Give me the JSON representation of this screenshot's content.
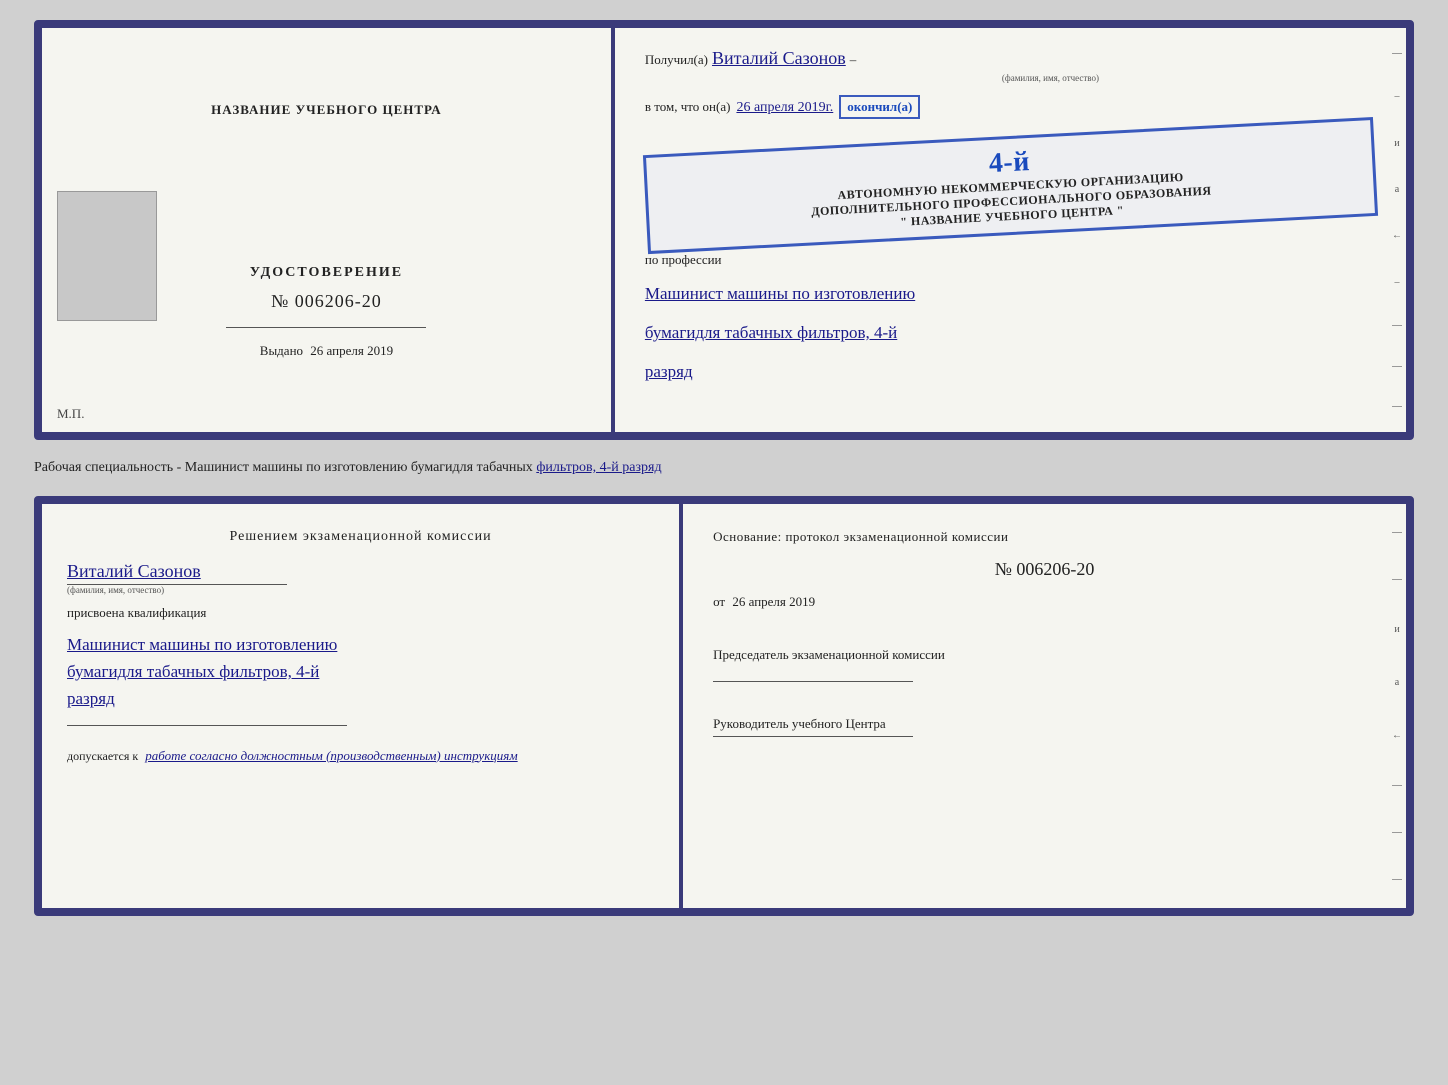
{
  "top": {
    "left": {
      "center_label": "НАЗВАНИЕ УЧЕБНОГО ЦЕНТРА",
      "udostoverenie_label": "УДОСТОВЕРЕНИЕ",
      "number": "№ 006206-20",
      "vydano_prefix": "Выдано",
      "vydano_date": "26 апреля 2019",
      "mp": "М.П."
    },
    "right": {
      "poluchil_prefix": "Получил(а)",
      "poluchil_name": "Виталий Сазонов",
      "fio_label": "(фамилия, имя, отчество)",
      "vtom_prefix": "в том, что он(а)",
      "vtom_date": "26 апреля 2019г.",
      "okonchil": "окончил(а)",
      "stamp_line1": "АВТОНОМНУЮ НЕКОММЕРЧЕСКУЮ ОРГАНИЗАЦИЮ",
      "stamp_line2": "ДОПОЛНИТЕЛЬНОГО ПРОФЕССИОНАЛЬНОГО ОБРАЗОВАНИЯ",
      "stamp_line3": "\" НАЗВАНИЕ УЧЕБНОГО ЦЕНТРА \"",
      "stamp_number": "4-й",
      "po_professii": "по профессии",
      "profession_line1": "Машинист машины по изготовлению",
      "profession_line2": "бумагидля табачных фильтров, 4-й",
      "profession_line3": "разряд"
    }
  },
  "subtitle": "Рабочая специальность - Машинист машины по изготовлению бумагидля табачных фильтров, 4-й разряд",
  "bottom": {
    "left": {
      "header": "Решением экзаменационной комиссии",
      "name": "Виталий Сазонов",
      "fio_label": "(фамилия, имя, отчество)",
      "prisvoena": "присвоена квалификация",
      "qual_line1": "Машинист машины по изготовлению",
      "qual_line2": "бумагидля табачных фильтров, 4-й",
      "qual_line3": "разряд",
      "dopuskaetsya": "допускается к",
      "dopusk_italic": "работе согласно должностным (производственным) инструкциям"
    },
    "right": {
      "osnov": "Основание: протокол экзаменационной комиссии",
      "number": "№ 006206-20",
      "ot_prefix": "от",
      "ot_date": "26 апреля 2019",
      "predsedatel_label": "Председатель экзаменационной комиссии",
      "rukovoditel_label": "Руководитель учебного Центра"
    }
  },
  "side_chars": [
    "–",
    "и",
    "а",
    "←",
    "–",
    "–",
    "–",
    "–"
  ]
}
